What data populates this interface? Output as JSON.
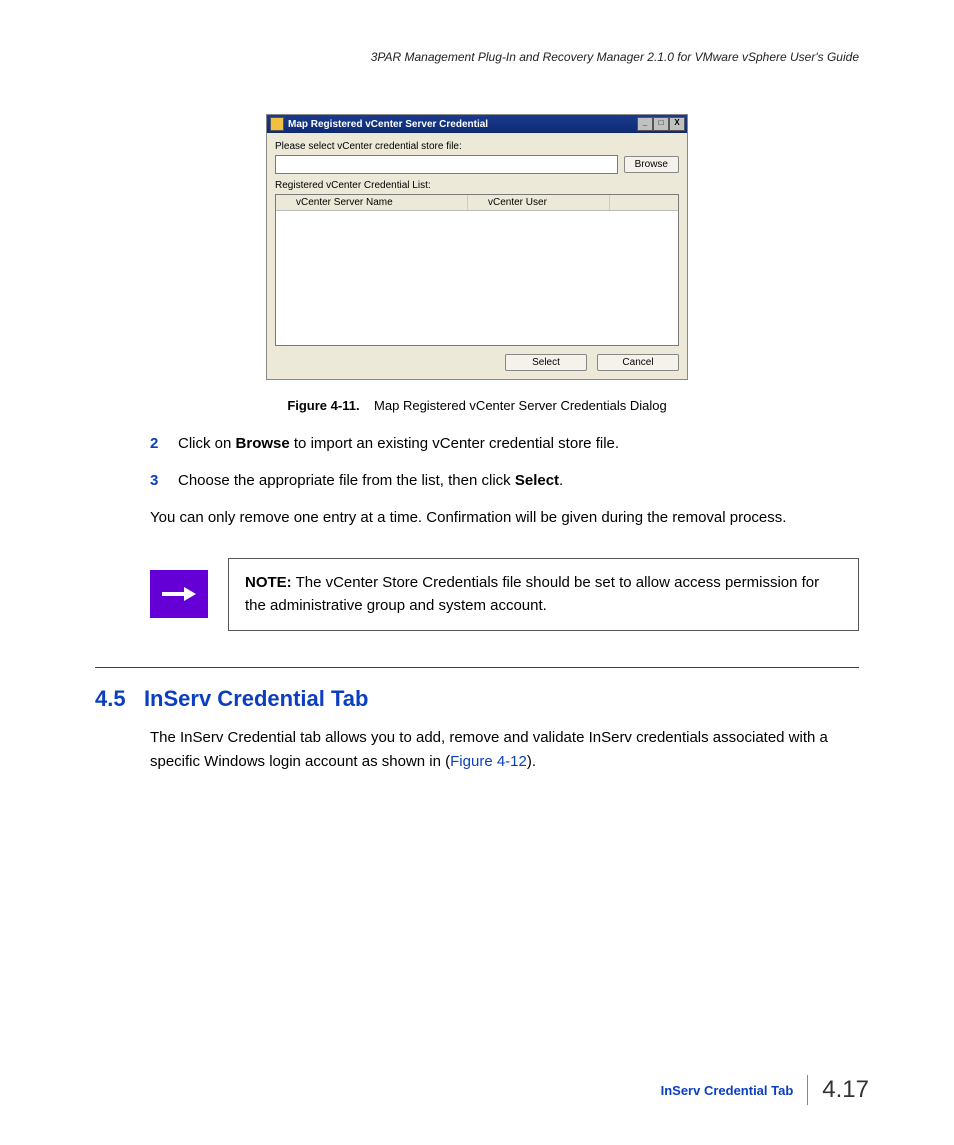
{
  "header": {
    "text": "3PAR Management Plug-In and Recovery Manager 2.1.0 for VMware vSphere User's Guide"
  },
  "dialog": {
    "title": "Map Registered vCenter Server Credential",
    "label_select_file": "Please select vCenter credential store file:",
    "browse_label": "Browse",
    "label_list": "Registered vCenter Credential List:",
    "col1": "vCenter Server Name",
    "col2": "vCenter User",
    "select_label": "Select",
    "cancel_label": "Cancel",
    "min": "_",
    "max": "□",
    "close": "X"
  },
  "figure": {
    "label": "Figure 4-11.",
    "caption": "Map Registered vCenter Server Credentials Dialog"
  },
  "steps": {
    "s2_num": "2",
    "s2_a": "Click on ",
    "s2_b": "Browse",
    "s2_c": " to import an existing vCenter credential store file.",
    "s3_num": "3",
    "s3_a": "Choose the appropriate file from the list, then click ",
    "s3_b": "Select",
    "s3_c": "."
  },
  "para1": "You can only remove one entry at a time. Confirmation will be given during the removal process.",
  "note": {
    "label": "NOTE:",
    "body": " The vCenter Store Credentials file should be set to allow access permission for the administrative group and system account."
  },
  "section": {
    "num": "4.5",
    "title": "InServ Credential Tab",
    "body_a": "The InServ Credential tab allows you to add, remove and validate InServ credentials associated with a specific Windows login account as shown in (",
    "body_link": "Figure 4-12",
    "body_b": ")."
  },
  "footer": {
    "label": "InServ Credential Tab",
    "page": "4.17"
  }
}
